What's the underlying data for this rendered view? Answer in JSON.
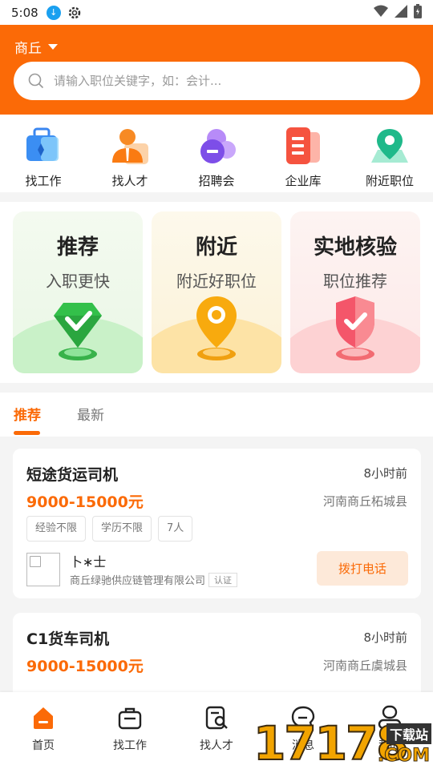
{
  "status_bar": {
    "time": "5:08"
  },
  "header": {
    "city": "商丘",
    "search_placeholder": "请输入职位关键字，如：会计..."
  },
  "quick_menu": [
    {
      "label": "找工作",
      "icon": "briefcase-icon"
    },
    {
      "label": "找人才",
      "icon": "person-icon"
    },
    {
      "label": "招聘会",
      "icon": "job-fair-icon"
    },
    {
      "label": "企业库",
      "icon": "company-library-icon"
    },
    {
      "label": "附近职位",
      "icon": "map-pin-icon"
    }
  ],
  "feature_cards": [
    {
      "title": "推荐",
      "subtitle": "入职更快",
      "icon": "diamond-check-icon",
      "color": "#3fc24e"
    },
    {
      "title": "附近",
      "subtitle": "附近好职位",
      "icon": "location-pin-icon",
      "color": "#f5a70a"
    },
    {
      "title": "实地核验",
      "subtitle": "职位推荐",
      "icon": "shield-check-icon",
      "color": "#f24d5d"
    }
  ],
  "tabs": {
    "active": "推荐",
    "inactive": "最新"
  },
  "jobs": [
    {
      "title": "短途货运司机",
      "time": "8小时前",
      "salary": "9000-15000元",
      "location": "河南商丘柘城县",
      "tags": [
        "经验不限",
        "学历不限",
        "7人"
      ],
      "contact": "卜∗士",
      "company": "商丘绿驰供应链管理有限公司",
      "verified": "认证",
      "call_label": "拨打电话"
    },
    {
      "title": "C1货车司机",
      "time": "8小时前",
      "salary": "9000-15000元",
      "location": "河南商丘虞城县"
    }
  ],
  "bottom_nav": [
    {
      "label": "首页",
      "icon": "home-icon",
      "active": true
    },
    {
      "label": "找工作",
      "icon": "briefcase-icon"
    },
    {
      "label": "找人才",
      "icon": "search-person-icon"
    },
    {
      "label": "消息",
      "icon": "message-icon"
    },
    {
      "label": "我的",
      "icon": "profile-icon"
    }
  ],
  "watermark": {
    "number": "17178",
    "text": "下载站",
    "domain": ".COM"
  },
  "colors": {
    "brand": "#fb6a07",
    "call_bg": "#fde9d9"
  }
}
